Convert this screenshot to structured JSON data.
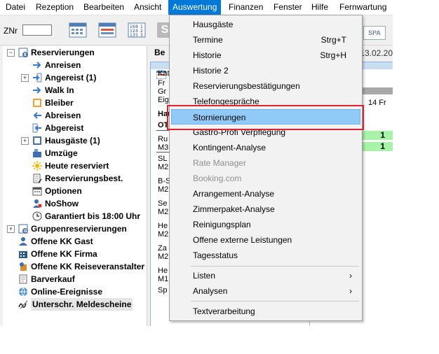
{
  "menubar": {
    "items": [
      "Datei",
      "Rezeption",
      "Bearbeiten",
      "Ansicht",
      "Auswertung",
      "Finanzen",
      "Fenster",
      "Hilfe",
      "Fernwartung"
    ],
    "active": "Auswertung"
  },
  "toolbar": {
    "znr_label": "ZNr",
    "znr_value": "",
    "s_label": "S",
    "spa_label": "SPA"
  },
  "tree": {
    "items": [
      {
        "label": "Reservierungen",
        "icon": "reservations-icon"
      },
      {
        "label": "Anreisen",
        "icon": "arrow-right-icon"
      },
      {
        "label": "Angereist (1)",
        "icon": "arrow-in-icon"
      },
      {
        "label": "Walk In",
        "icon": "arrow-right-icon"
      },
      {
        "label": "Bleiber",
        "icon": "square-icon"
      },
      {
        "label": "Abreisen",
        "icon": "arrow-left-icon"
      },
      {
        "label": "Abgereist",
        "icon": "arrow-out-icon"
      },
      {
        "label": "Hausgäste (1)",
        "icon": "square-icon"
      },
      {
        "label": "Umzüge",
        "icon": "move-icon"
      },
      {
        "label": "Heute reserviert",
        "icon": "sun-icon"
      },
      {
        "label": "Reservierungsbest.",
        "icon": "document-icon"
      },
      {
        "label": "Optionen",
        "icon": "calendar-icon"
      },
      {
        "label": "NoShow",
        "icon": "person-cross-icon"
      },
      {
        "label": "Garantiert bis 18:00 Uhr",
        "icon": "clock-icon"
      },
      {
        "label": "Gruppenreservierungen",
        "icon": "group-icon"
      },
      {
        "label": "Offene KK Gast",
        "icon": "person-icon"
      },
      {
        "label": "Offene KK Firma",
        "icon": "company-icon"
      },
      {
        "label": "Offene KK Reiseveranstalter",
        "icon": "travel-icon"
      },
      {
        "label": "Barverkauf",
        "icon": "cash-icon"
      },
      {
        "label": "Online-Ereignisse",
        "icon": "globe-icon"
      },
      {
        "label": "Unterschr. Meldescheine",
        "icon": "signature-icon"
      }
    ]
  },
  "right": {
    "tab_label": "Be",
    "date": "13.02.20",
    "rows": [
      {
        "text": "Kat",
        "bold": false
      },
      {
        "text": "Fr",
        "bold": false
      },
      {
        "text": "Gr",
        "bold": false
      },
      {
        "text": "Eig",
        "bold": false
      },
      {
        "text": "Hau",
        "bold": true
      },
      {
        "text": "OT",
        "bold": true
      },
      {
        "text": "Ru",
        "bold": false
      },
      {
        "text": "M3",
        "bold": false
      },
      {
        "text": "SL",
        "bold": false
      },
      {
        "text": "M2",
        "bold": false
      },
      {
        "text": "B-S",
        "bold": false
      },
      {
        "text": "M2",
        "bold": false
      },
      {
        "text": "Se",
        "bold": false
      },
      {
        "text": "M2",
        "bold": false
      },
      {
        "text": "He",
        "bold": false
      },
      {
        "text": "M2",
        "bold": false
      },
      {
        "text": "Za",
        "bold": false
      },
      {
        "text": "M2",
        "bold": false
      },
      {
        "text": "He",
        "bold": false
      },
      {
        "text": "M1",
        "bold": false
      },
      {
        "text": "Sp",
        "bold": false
      }
    ],
    "fr_value": "14 Fr",
    "green_values": [
      "1",
      "1"
    ]
  },
  "dropdown": {
    "items": [
      {
        "label": "Hausgäste",
        "shortcut": "",
        "disabled": false
      },
      {
        "label": "Termine",
        "shortcut": "Strg+T",
        "disabled": false
      },
      {
        "label": "Historie",
        "shortcut": "Strg+H",
        "disabled": false
      },
      {
        "label": "Historie 2",
        "shortcut": "",
        "disabled": false
      },
      {
        "label": "Reservierungsbestätigungen",
        "shortcut": "",
        "disabled": false
      },
      {
        "label": "Telefongespräche",
        "shortcut": "",
        "disabled": false
      },
      {
        "label": "Stornierungen",
        "shortcut": "",
        "disabled": false,
        "highlighted": true
      },
      {
        "label": "Gastro-Profi Verpflegung",
        "shortcut": "",
        "disabled": false
      },
      {
        "label": "Kontingent-Analyse",
        "shortcut": "",
        "disabled": false
      },
      {
        "label": "Rate Manager",
        "shortcut": "",
        "disabled": true
      },
      {
        "label": "Booking.com",
        "shortcut": "",
        "disabled": true
      },
      {
        "label": "Arrangement-Analyse",
        "shortcut": "",
        "disabled": false
      },
      {
        "label": "Zimmerpaket-Analyse",
        "shortcut": "",
        "disabled": false
      },
      {
        "label": "Reinigungsplan",
        "shortcut": "",
        "disabled": false
      },
      {
        "label": "Offene externe Leistungen",
        "shortcut": "",
        "disabled": false
      },
      {
        "label": "Tagesstatus",
        "shortcut": "",
        "disabled": false
      }
    ],
    "submenus": [
      {
        "label": "Listen"
      },
      {
        "label": "Analysen"
      }
    ],
    "last": {
      "label": "Textverarbeitung"
    }
  },
  "colors": {
    "menu_active": "#0078d7",
    "highlight": "#91c9f7",
    "annotation": "#e0202a",
    "green": "#a7f3a7"
  }
}
